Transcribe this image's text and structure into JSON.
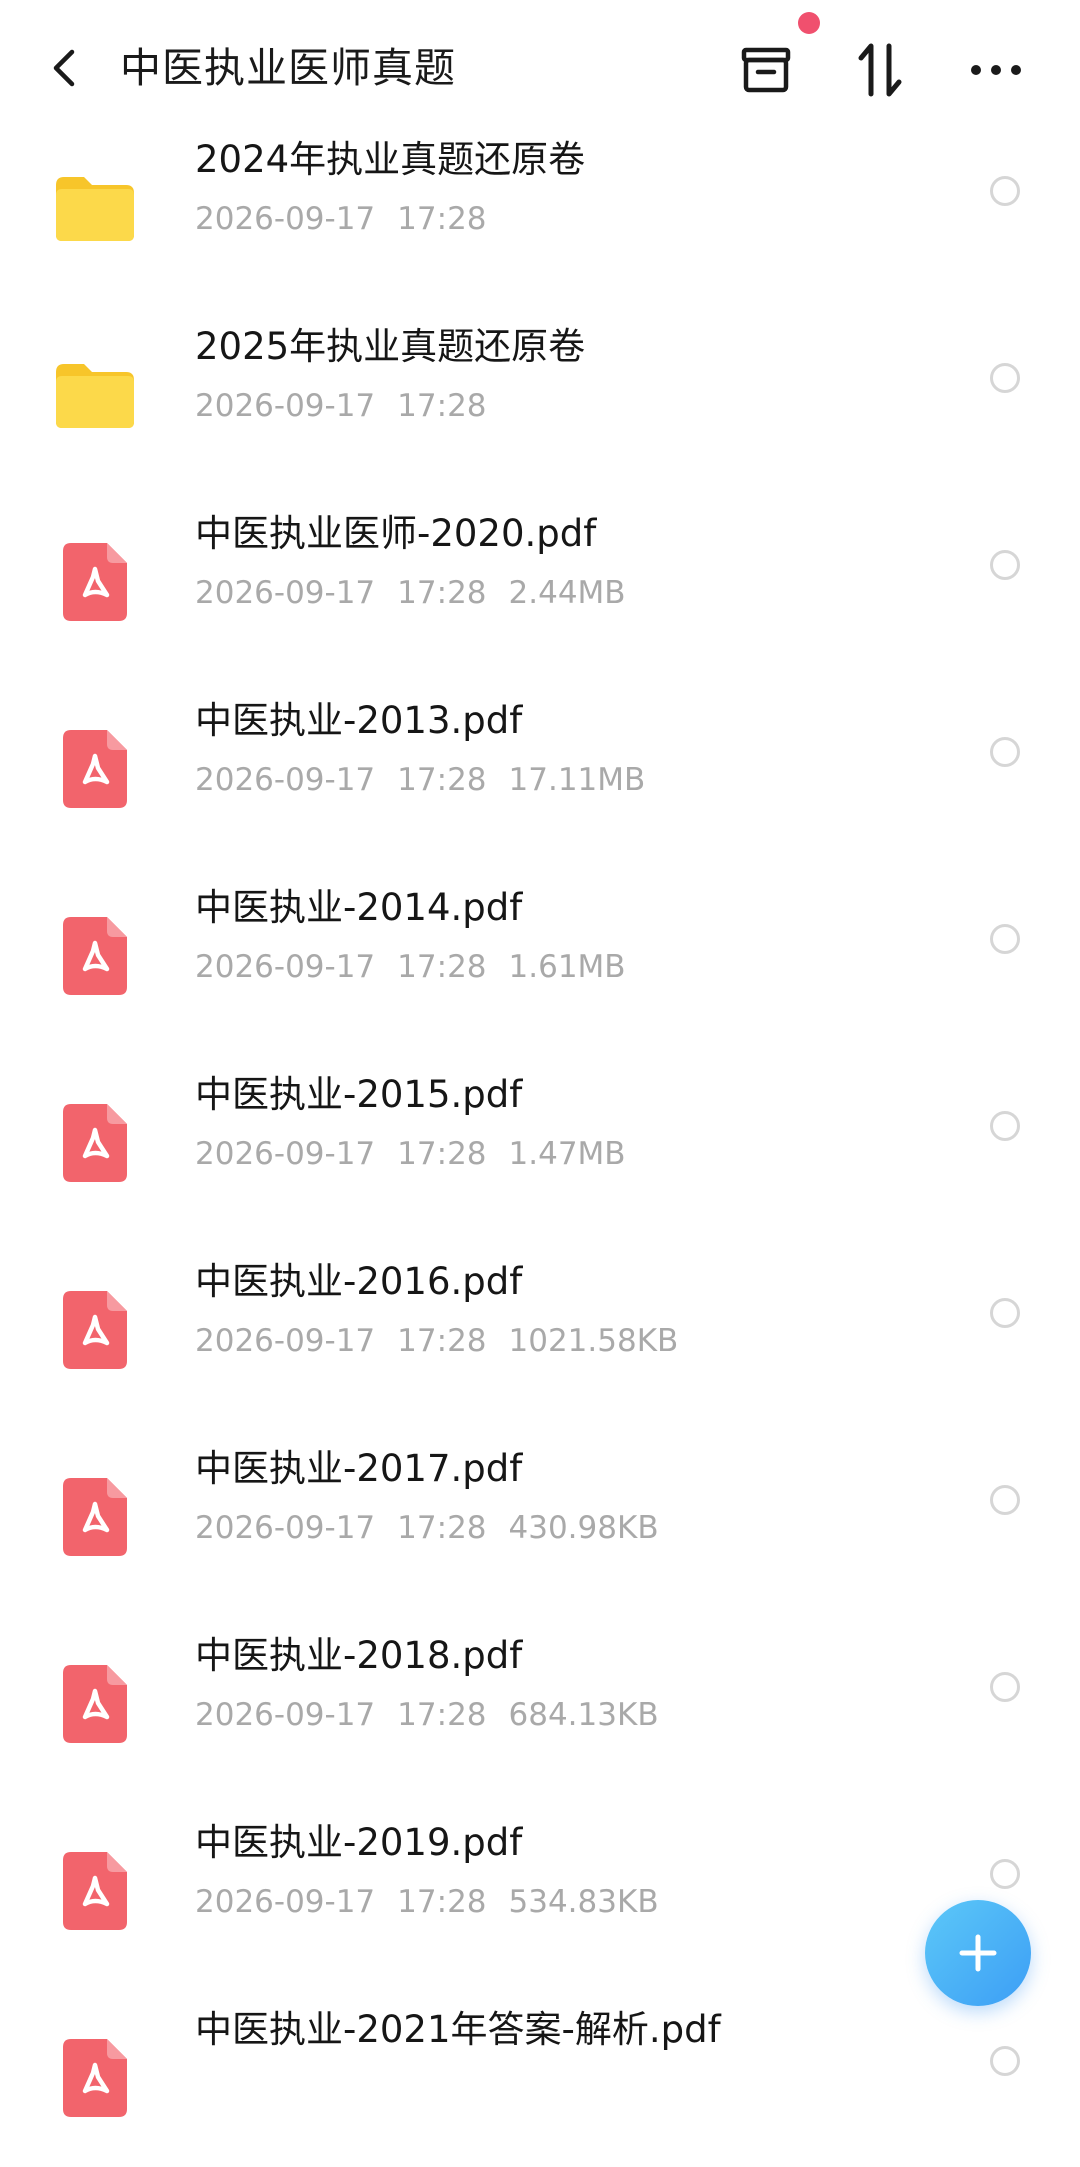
{
  "header": {
    "title": "中医执业医师真题",
    "back_icon": "chevron-left-icon",
    "archive_icon": "archive-box-icon",
    "sort_icon": "sort-arrows-icon",
    "more_icon": "more-dots-icon",
    "notification_color": "#f0506e"
  },
  "files": [
    {
      "type": "folder",
      "name": "2024年执业真题还原卷",
      "date": "2026-09-17",
      "time": "17:28",
      "size": ""
    },
    {
      "type": "folder",
      "name": "2025年执业真题还原卷",
      "date": "2026-09-17",
      "time": "17:28",
      "size": ""
    },
    {
      "type": "pdf",
      "name": "中医执业医师-2020.pdf",
      "date": "2026-09-17",
      "time": "17:28",
      "size": "2.44MB"
    },
    {
      "type": "pdf",
      "name": "中医执业-2013.pdf",
      "date": "2026-09-17",
      "time": "17:28",
      "size": "17.11MB"
    },
    {
      "type": "pdf",
      "name": "中医执业-2014.pdf",
      "date": "2026-09-17",
      "time": "17:28",
      "size": "1.61MB"
    },
    {
      "type": "pdf",
      "name": "中医执业-2015.pdf",
      "date": "2026-09-17",
      "time": "17:28",
      "size": "1.47MB"
    },
    {
      "type": "pdf",
      "name": "中医执业-2016.pdf",
      "date": "2026-09-17",
      "time": "17:28",
      "size": "1021.58KB"
    },
    {
      "type": "pdf",
      "name": "中医执业-2017.pdf",
      "date": "2026-09-17",
      "time": "17:28",
      "size": "430.98KB"
    },
    {
      "type": "pdf",
      "name": "中医执业-2018.pdf",
      "date": "2026-09-17",
      "time": "17:28",
      "size": "684.13KB"
    },
    {
      "type": "pdf",
      "name": "中医执业-2019.pdf",
      "date": "2026-09-17",
      "time": "17:28",
      "size": "534.83KB"
    },
    {
      "type": "pdf",
      "name": "中医执业-2021年答案-解析.pdf",
      "date": "",
      "time": "",
      "size": ""
    }
  ],
  "fab": {
    "icon": "plus-icon"
  },
  "colors": {
    "folder": "#fcd23c",
    "pdf": "#f2646c",
    "fab_start": "#5cc8f8",
    "fab_end": "#3c9ef5"
  }
}
